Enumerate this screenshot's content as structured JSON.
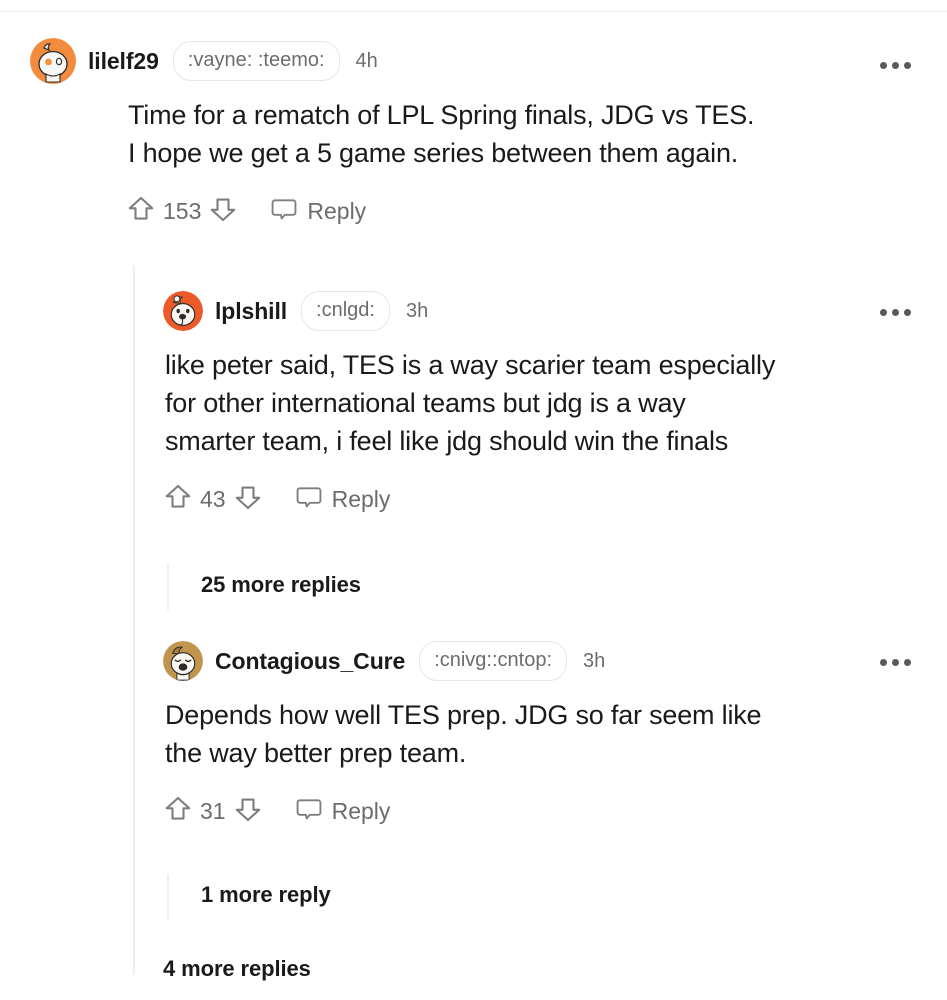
{
  "page": {
    "kind": "reddit-comment-thread",
    "background": "#ffffff",
    "text_color": "#1a1a1b",
    "muted_color": "#6a6d70",
    "thread_line_color": "#edeff1",
    "divider_color": "#eceef0"
  },
  "comments": [
    {
      "id": "comment-1",
      "username": "lilelf29",
      "flair": ":vayne: :teemo:",
      "timestamp": "4h",
      "body": "Time for a rematch of LPL Spring finals, JDG vs TES.\nI hope we get a 5 game series between them again.",
      "score": "153",
      "reply_label": "Reply",
      "avatar": {
        "name": "snoo-avatar-orange",
        "background": "#f28c3c",
        "face": "#f7f7f5",
        "outline": "#2b2b2b",
        "accent": "#e8803a"
      },
      "overflow_label": "more options"
    },
    {
      "id": "comment-2",
      "username": "lplshill",
      "flair": ":cnlgd:",
      "timestamp": "3h",
      "body": "like peter said, TES is a way scarier team especially\nfor other international teams but jdg is a way\nsmarter team, i feel like jdg should win the finals",
      "score": "43",
      "reply_label": "Reply",
      "avatar": {
        "name": "snoo-avatar-dog-red",
        "background": "#ec5a2a",
        "face": "#faf7f2",
        "outline": "#2b2b2b",
        "accent": "#d9451c"
      },
      "overflow_label": "more options"
    },
    {
      "id": "comment-3",
      "username": "Contagious_Cure",
      "flair": ":cnivg::cntop:",
      "timestamp": "3h",
      "body": "Depends how well TES prep. JDG so far seem like\nthe way better prep team.",
      "score": "31",
      "reply_label": "Reply",
      "avatar": {
        "name": "snoo-avatar-tan",
        "background": "#c2954e",
        "face": "#fbf8f2",
        "outline": "#2b2b2b",
        "accent": "#a87f3c"
      },
      "overflow_label": "more options"
    }
  ],
  "more_replies": [
    {
      "id": "more-replies-1",
      "label": "25 more replies"
    },
    {
      "id": "more-replies-2",
      "label": "1 more reply"
    },
    {
      "id": "more-replies-3",
      "label": "4 more replies"
    }
  ],
  "icons": {
    "upvote": "upvote-arrow-icon",
    "downvote": "downvote-arrow-icon",
    "reply": "reply-bubble-icon",
    "overflow": "overflow-menu-icon"
  }
}
